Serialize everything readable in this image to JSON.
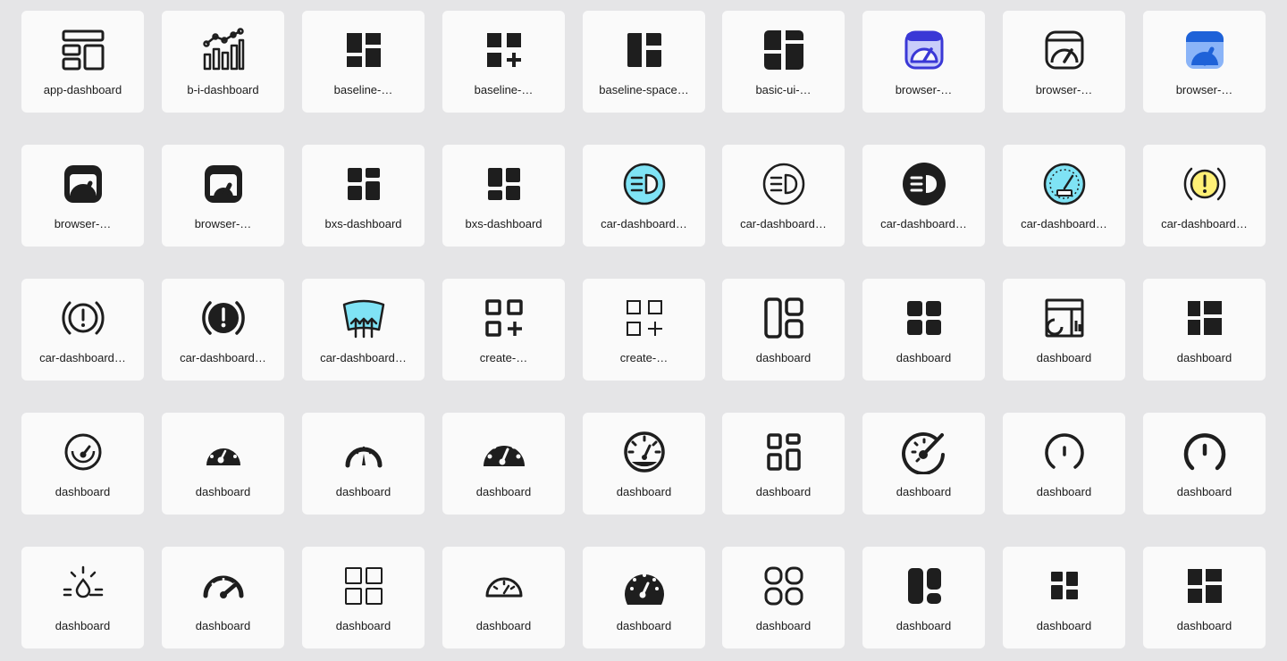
{
  "icons": [
    {
      "label": "app-dashboard",
      "icon": "app-dashboard-icon"
    },
    {
      "label": "b-i-dashboard",
      "icon": "bi-dashboard-icon"
    },
    {
      "label": "baseline-…",
      "icon": "baseline-dashboard-icon"
    },
    {
      "label": "baseline-…",
      "icon": "baseline-dashboard-customize-icon"
    },
    {
      "label": "baseline-space…",
      "icon": "baseline-space-dashboard-icon"
    },
    {
      "label": "basic-ui-…",
      "icon": "basic-ui-dashboard-icon"
    },
    {
      "label": "browser-…",
      "icon": "browser-dashboard-blue-outline-icon"
    },
    {
      "label": "browser-…",
      "icon": "browser-dashboard-outline-icon"
    },
    {
      "label": "browser-…",
      "icon": "browser-dashboard-blue-filled-icon"
    },
    {
      "label": "browser-…",
      "icon": "browser-dashboard-filled-icon"
    },
    {
      "label": "browser-…",
      "icon": "browser-dashboard-filled-alt-icon"
    },
    {
      "label": "bxs-dashboard",
      "icon": "bxs-dashboard-icon"
    },
    {
      "label": "bxs-dashboard",
      "icon": "bxs-dashboard-alt-icon"
    },
    {
      "label": "car-dashboard…",
      "icon": "headlight-cyan-icon"
    },
    {
      "label": "car-dashboard…",
      "icon": "headlight-outline-icon"
    },
    {
      "label": "car-dashboard…",
      "icon": "headlight-filled-icon"
    },
    {
      "label": "car-dashboard…",
      "icon": "speedometer-cyan-icon"
    },
    {
      "label": "car-dashboard…",
      "icon": "warning-yellow-icon"
    },
    {
      "label": "car-dashboard…",
      "icon": "brake-warning-outline-icon"
    },
    {
      "label": "car-dashboard…",
      "icon": "brake-warning-filled-icon"
    },
    {
      "label": "car-dashboard…",
      "icon": "windshield-defrost-icon"
    },
    {
      "label": "create-…",
      "icon": "create-dashboard-icon"
    },
    {
      "label": "create-…",
      "icon": "create-dashboard-thin-icon"
    },
    {
      "label": "dashboard",
      "icon": "dashboard-outline-icon"
    },
    {
      "label": "dashboard",
      "icon": "dashboard-filled-icon"
    },
    {
      "label": "dashboard",
      "icon": "dashboard-report-icon"
    },
    {
      "label": "dashboard",
      "icon": "dashboard-sharp-icon"
    },
    {
      "label": "dashboard",
      "icon": "gauge-circle-icon"
    },
    {
      "label": "dashboard",
      "icon": "gauge-filled-small-icon"
    },
    {
      "label": "dashboard",
      "icon": "gauge-arc-icon"
    },
    {
      "label": "dashboard",
      "icon": "gauge-filled-icon"
    },
    {
      "label": "dashboard",
      "icon": "gauge-ticks-icon"
    },
    {
      "label": "dashboard",
      "icon": "grid-rounded-icon"
    },
    {
      "label": "dashboard",
      "icon": "speedometer-needle-icon"
    },
    {
      "label": "dashboard",
      "icon": "gauge-open-icon"
    },
    {
      "label": "dashboard",
      "icon": "gauge-open-bold-icon"
    },
    {
      "label": "dashboard",
      "icon": "drop-light-icon"
    },
    {
      "label": "dashboard",
      "icon": "speedometer-arc-icon"
    },
    {
      "label": "dashboard",
      "icon": "grid-squares-outline-icon"
    },
    {
      "label": "dashboard",
      "icon": "gauge-half-icon"
    },
    {
      "label": "dashboard",
      "icon": "gauge-round-filled-icon"
    },
    {
      "label": "dashboard",
      "icon": "grid-circles-outline-icon"
    },
    {
      "label": "dashboard",
      "icon": "dashboard-rounded-filled-icon"
    },
    {
      "label": "dashboard",
      "icon": "dashboard-small-filled-icon"
    },
    {
      "label": "dashboard",
      "icon": "dashboard-sharp-alt-icon"
    }
  ]
}
